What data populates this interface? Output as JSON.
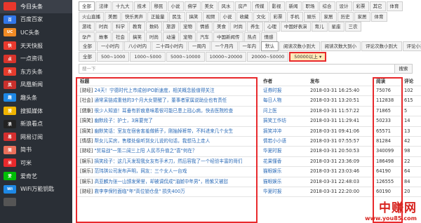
{
  "sidebar": {
    "items": [
      {
        "label": "今日头条",
        "icon": "toutiao-icon",
        "badge": "",
        "color": "#e8372c"
      },
      {
        "label": "百度百家",
        "icon": "baidu-icon",
        "badge": "百",
        "color": "#3176e8"
      },
      {
        "label": "UC头条",
        "icon": "uc-icon",
        "badge": "UC",
        "color": "#f08a24"
      },
      {
        "label": "天天快报",
        "icon": "kuaibao-icon",
        "badge": "快",
        "color": "#e83a2e"
      },
      {
        "label": "一点资讯",
        "icon": "yidian-icon",
        "badge": "点",
        "color": "#d9342b"
      },
      {
        "label": "东方头条",
        "icon": "dongfang-icon",
        "badge": "东",
        "color": "#e53b2c"
      },
      {
        "label": "凤凰新闻",
        "icon": "ifeng-icon",
        "badge": "凤",
        "color": "#c9302c"
      },
      {
        "label": "趣头条",
        "icon": "qutoutiao-icon",
        "badge": "趣",
        "color": "#1e88e5"
      },
      {
        "label": "搜狐媒体",
        "icon": "sohu-icon",
        "badge": "搜",
        "color": "#f0b400"
      },
      {
        "label": "新浪看点",
        "icon": "sina-icon",
        "badge": "浪",
        "color": "#222222"
      },
      {
        "label": "网易订阅",
        "icon": "netease-icon",
        "badge": "易",
        "color": "#d32f2f"
      },
      {
        "label": "简书",
        "icon": "jianshu-icon",
        "badge": "简",
        "color": "#ea6f5a"
      },
      {
        "label": "可米",
        "icon": "kemi-icon",
        "badge": "米",
        "color": "#e8292c"
      },
      {
        "label": "爱奇艺",
        "icon": "iqiyi-icon",
        "badge": "爱",
        "color": "#00be06"
      },
      {
        "label": "WiFi万能钥匙",
        "icon": "wifi-icon",
        "badge": "Wi",
        "color": "#1e88e5"
      },
      {
        "label": "",
        "icon": "more-icon",
        "badge": "",
        "color": "#555555"
      }
    ]
  },
  "categories": {
    "rows": [
      [
        "全部",
        "法律",
        "十九大",
        "技术",
        "移民",
        "小说",
        "佛学",
        "美女",
        "风水",
        "房产",
        "传媒",
        "影视",
        "新闻",
        "职场",
        "综合",
        "设计",
        "彩票",
        "其它",
        "体育"
      ],
      [
        "火山直播",
        "美图",
        "快乐男声",
        "正能量",
        "民生",
        "搞笑",
        "视频",
        "小说",
        "收藏",
        "文化",
        "彩票",
        "手机",
        "娱乐",
        "家居",
        "历史",
        "家居",
        "体育"
      ],
      [
        "游戏",
        "时尚",
        "科学",
        "教育",
        "数码",
        "旅游",
        "宠物",
        "情感",
        "美食",
        "时尚",
        "养生",
        "心理",
        "中国好表演",
        "育儿",
        "星座",
        "三农"
      ],
      [
        "孕产",
        "故事",
        "社会",
        "搞笑",
        "时尚",
        "动漫",
        "宠物",
        "汽车",
        "中国新闻传",
        "热点",
        "情感"
      ]
    ]
  },
  "time_filter": {
    "options": [
      "全部",
      "一小时内",
      "八小时内",
      "二十四小时内",
      "一周内",
      "一个月内",
      "一年内",
      "默认",
      "阅读次数小到大",
      "阅读次数大到小",
      "评论次数小到大",
      "评论小到大"
    ],
    "selected": "默认"
  },
  "read_filter": {
    "options": [
      "全部",
      "500~1000",
      "1000~5000",
      "5000~10000",
      "10000~20000",
      "20000~50000",
      "50000以上 ▾"
    ],
    "selected": "50000以上 ▾"
  },
  "search": {
    "placeholder": "搜一下",
    "button": "搜索"
  },
  "table": {
    "headers": {
      "title": "标题",
      "author": "作者",
      "time": "发布",
      "read": "阅读",
      "comment": "评论"
    },
    "rows": [
      {
        "cat": "[财经]",
        "title": "24天！宁德时代上市成创IPO新速度，相关概念股值得关注",
        "author": "证券时报",
        "time": "2018-03-31 16:25:40",
        "read": "75076",
        "comment": "102"
      },
      {
        "cat": "[社会]",
        "title": "通常呆链成重他的3个月大女婴醒了，董事者家属说助业也有责任",
        "author": "每日人物",
        "time": "2018-03-31 13:20:51",
        "read": "112838",
        "comment": "615"
      },
      {
        "cat": "[健康]",
        "title": "很少人知道！耳垂有折痕意味着很可能已患上冠心病，快去医院检查",
        "author": "问上医",
        "time": "2018-03-31 11:57:22",
        "read": "71865",
        "comment": "5"
      },
      {
        "cat": "[搞笑]",
        "title": "幽默段子：护士，3床要完了",
        "author": "搞笑工作坊",
        "time": "2018-03-31 11:29:41",
        "read": "50233",
        "comment": "14"
      },
      {
        "cat": "[搞笑]",
        "title": "幽默笑话：室友在宿舍害羞做裤子，刚抽掉裤带，不料进来几个女生",
        "author": "搞笑冲冲",
        "time": "2018-03-31 09:41:06",
        "read": "65571",
        "comment": "13"
      },
      {
        "cat": "[情感]",
        "title": "帮女儿买房，售楼处偷听到女儿说的句话，我想马上走人",
        "author": "情若小小语",
        "time": "2018-03-31 07:55:57",
        "read": "81284",
        "comment": "42"
      },
      {
        "cat": "[财经]",
        "title": "\"贸易战\"一策二阔三上阳 人民币升值之\"喜\"何在？",
        "author": "华夏时报",
        "time": "2018-03-31 20:50:53",
        "read": "340099",
        "comment": "98"
      },
      {
        "cat": "[娱乐]",
        "title": "搞笑段子：这几天发现我女友有手术刀，然后容我了一个经验丰富的哥们",
        "author": "花果懂香",
        "time": "2018-03-31 23:36:09",
        "read": "186498",
        "comment": "22"
      },
      {
        "cat": "[娱乐]",
        "title": "范玮琪公司发布声明，网友：三个女人一台戏",
        "author": "猫眼娱乐",
        "time": "2018-03-31 23:03:46",
        "read": "64190",
        "comment": "64"
      },
      {
        "cat": "[娱乐]",
        "title": "高亚麟为张一山颁发荣誉，却被调侃成\"油腻中年男\"，杨紫又被怼",
        "author": "猫眼娱乐",
        "time": "2018-03-31 22:48:03",
        "read": "126555",
        "comment": "84"
      },
      {
        "cat": "[财经]",
        "title": "救李李保险面临\"年\"高位锁仓盘\" 损失400万",
        "author": "华夏时报",
        "time": "2018-03-31 22:20:00",
        "read": "60190",
        "comment": "20"
      }
    ]
  },
  "watermark": {
    "text": "中赚网",
    "url": "www.you85.com"
  },
  "colors": {
    "accent_red": "#e8292c",
    "link_blue": "#2a6ab7",
    "sidebar_bg": "#2a2f36"
  }
}
